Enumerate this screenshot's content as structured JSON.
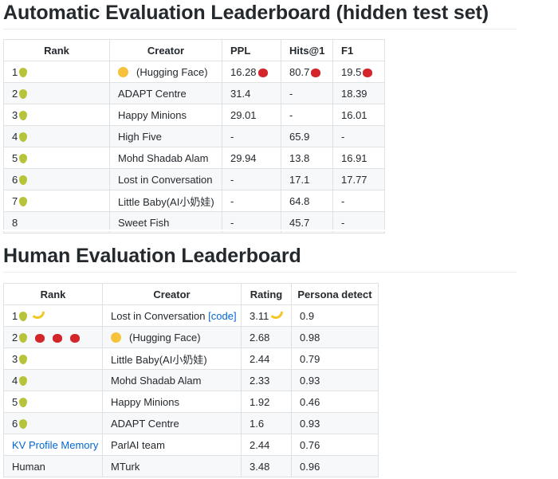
{
  "auto": {
    "title": "Automatic Evaluation Leaderboard (hidden test set)",
    "headers": [
      "Rank",
      "Creator",
      "PPL",
      "Hits@1",
      "F1"
    ],
    "rows": [
      {
        "rank": "1",
        "rank_icons": [
          "pear"
        ],
        "creator": "(Hugging Face)",
        "creator_icon": "hugging-face",
        "ppl": "16.28",
        "ppl_icon": "apple",
        "hits": "80.7",
        "hits_icon": "apple",
        "f1": "19.5",
        "f1_icon": "apple"
      },
      {
        "rank": "2",
        "rank_icons": [
          "pear"
        ],
        "creator": "ADAPT Centre",
        "ppl": "31.4",
        "hits": "-",
        "f1": "18.39"
      },
      {
        "rank": "3",
        "rank_icons": [
          "pear"
        ],
        "creator": "Happy Minions",
        "ppl": "29.01",
        "hits": "-",
        "f1": "16.01"
      },
      {
        "rank": "4",
        "rank_icons": [
          "pear"
        ],
        "creator": "High Five",
        "ppl": "-",
        "hits": "65.9",
        "f1": "-"
      },
      {
        "rank": "5",
        "rank_icons": [
          "pear"
        ],
        "creator": "Mohd Shadab Alam",
        "ppl": "29.94",
        "hits": "13.8",
        "f1": "16.91"
      },
      {
        "rank": "6",
        "rank_icons": [
          "pear"
        ],
        "creator": "Lost in Conversation",
        "ppl": "-",
        "hits": "17.1",
        "f1": "17.77"
      },
      {
        "rank": "7",
        "rank_icons": [
          "pear"
        ],
        "creator": "Little Baby(AI小奶娃)",
        "ppl": "-",
        "hits": "64.8",
        "f1": "-"
      },
      {
        "rank": "8",
        "rank_icons": [],
        "creator": "Sweet Fish",
        "ppl": "-",
        "hits": "45.7",
        "f1": "-"
      }
    ]
  },
  "human": {
    "title": "Human Evaluation Leaderboard",
    "headers": [
      "Rank",
      "Creator",
      "Rating",
      "Persona detect"
    ],
    "rows": [
      {
        "rank": "1",
        "rank_icons": [
          "pear",
          "banana"
        ],
        "creator": "Lost in Conversation",
        "creator_link": "[code]",
        "rating": "3.11",
        "rating_icon": "banana",
        "persona": "0.9"
      },
      {
        "rank": "2",
        "rank_icons": [
          "pear",
          "apple",
          "apple",
          "apple"
        ],
        "creator": "(Hugging Face)",
        "creator_icon": "hugging-face",
        "rating": "2.68",
        "persona": "0.98"
      },
      {
        "rank": "3",
        "rank_icons": [
          "pear"
        ],
        "creator": "Little Baby(AI小奶娃)",
        "rating": "2.44",
        "persona": "0.79"
      },
      {
        "rank": "4",
        "rank_icons": [
          "pear"
        ],
        "creator": "Mohd Shadab Alam",
        "rating": "2.33",
        "persona": "0.93"
      },
      {
        "rank": "5",
        "rank_icons": [
          "pear"
        ],
        "creator": "Happy Minions",
        "rating": "1.92",
        "persona": "0.46"
      },
      {
        "rank": "6",
        "rank_icons": [
          "pear"
        ],
        "creator": "ADAPT Centre",
        "rating": "1.6",
        "persona": "0.93"
      },
      {
        "rank": "KV Profile Memory",
        "rank_is_link": true,
        "rank_icons": [],
        "creator": "ParlAI team",
        "rating": "2.44",
        "persona": "0.76"
      },
      {
        "rank": "Human",
        "rank_icons": [],
        "creator": "MTurk",
        "rating": "3.48",
        "persona": "0.96"
      }
    ]
  },
  "colors": {
    "link": "#0366d6",
    "border": "#dfe2e5",
    "stripe": "#f6f8fa"
  }
}
